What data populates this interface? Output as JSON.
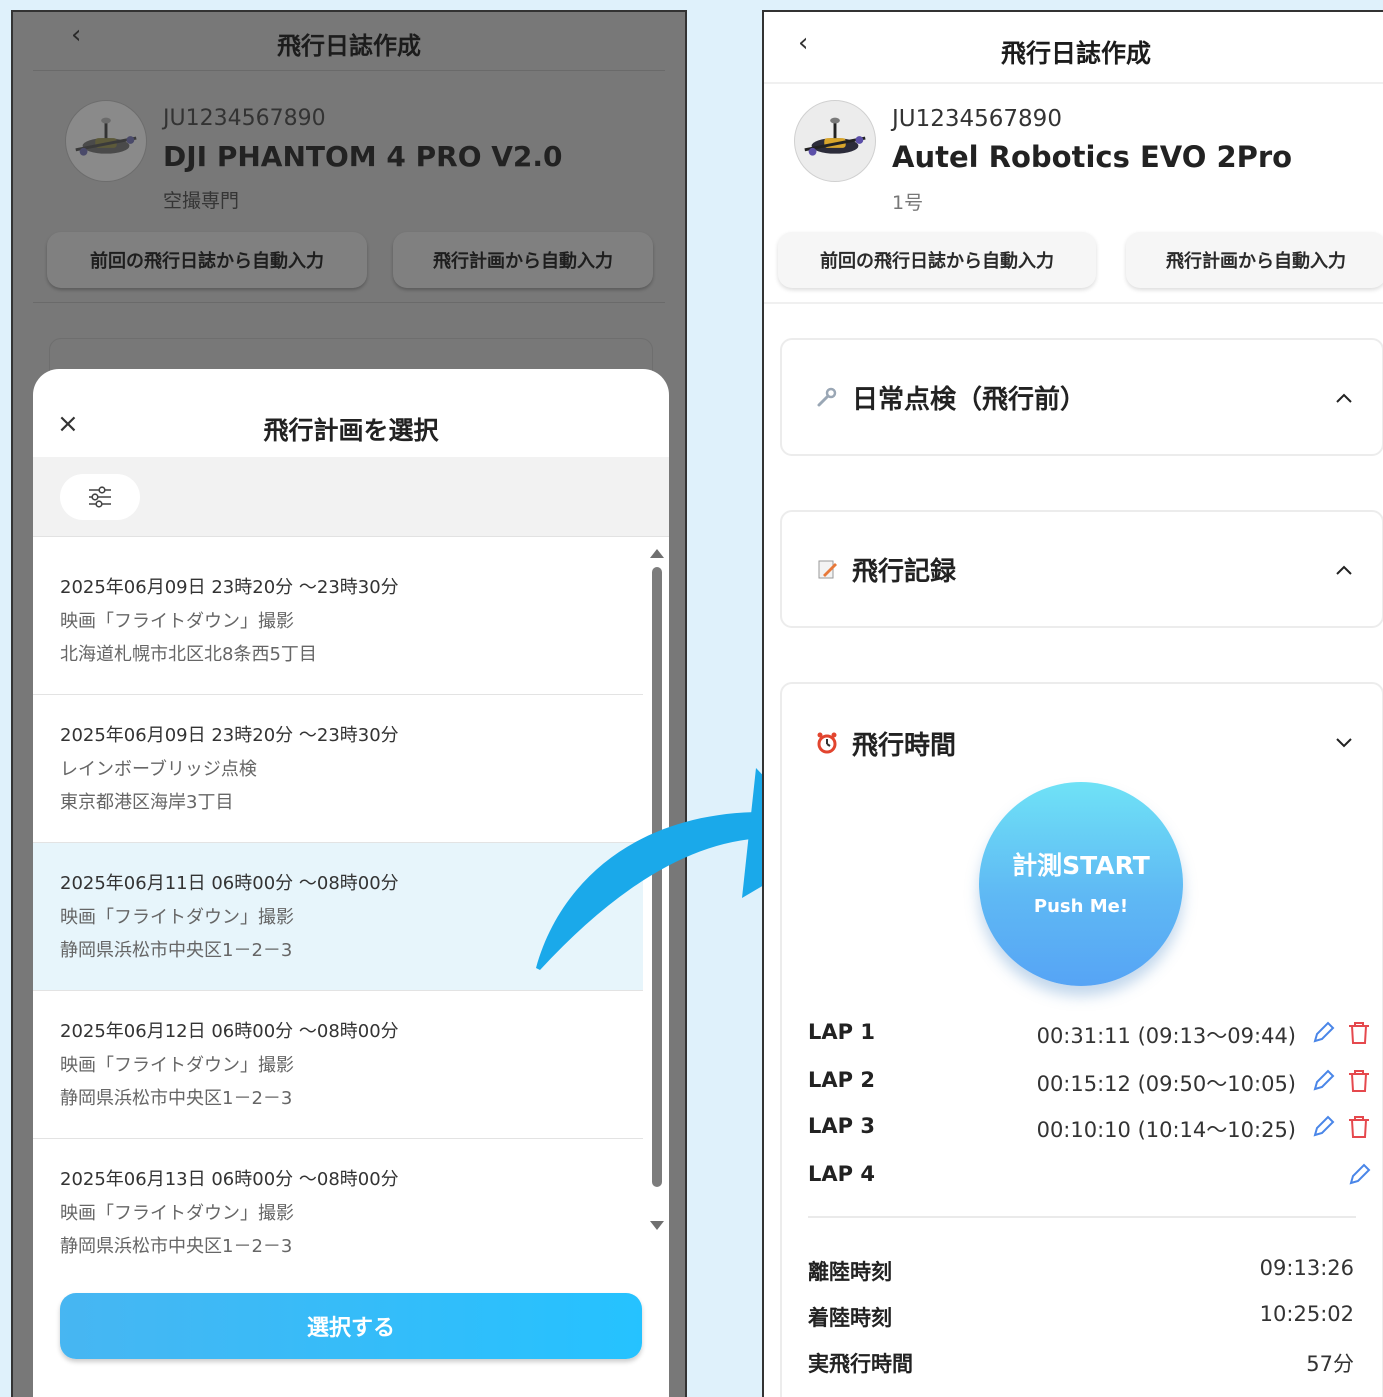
{
  "colors": {
    "background": "#dff1fb",
    "accent": "#1aa9ea",
    "danger": "#e5484d",
    "edit": "#4a86e8"
  },
  "left": {
    "back_icon": "chevron-left-icon",
    "title": "飛行日誌作成",
    "uav": {
      "id": "JU1234567890",
      "name": "DJI PHANTOM 4 PRO V2.0",
      "sub": "空撮専門"
    },
    "auto_prev": "前回の飛行日誌から自動入力",
    "auto_plan": "飛行計画から自動入力",
    "sheet": {
      "close": "×",
      "title": "飛行計画を選択",
      "filter_icon": "sliders-icon",
      "items": [
        {
          "date": "2025年06月09日 23時20分 ～23時30分",
          "name": "映画「フライトダウン」撮影",
          "addr": "北海道札幌市北区北8条西5丁目",
          "selected": false
        },
        {
          "date": "2025年06月09日 23時20分 ～23時30分",
          "name": "レインボーブリッジ点検",
          "addr": "東京都港区海岸3丁目",
          "selected": false
        },
        {
          "date": "2025年06月11日 06時00分 ～08時00分",
          "name": "映画「フライトダウン」撮影",
          "addr": "静岡県浜松市中央区1－2－3",
          "selected": true
        },
        {
          "date": "2025年06月12日 06時00分 ～08時00分",
          "name": "映画「フライトダウン」撮影",
          "addr": "静岡県浜松市中央区1－2－3",
          "selected": false
        },
        {
          "date": "2025年06月13日 06時00分 ～08時00分",
          "name": "映画「フライトダウン」撮影",
          "addr": "静岡県浜松市中央区1－2－3",
          "selected": false
        }
      ],
      "select_label": "選択する"
    }
  },
  "right": {
    "back_icon": "chevron-left-icon",
    "title": "飛行日誌作成",
    "uav": {
      "id": "JU1234567890",
      "name": "Autel Robotics EVO 2Pro",
      "sub": "1号"
    },
    "auto_prev": "前回の飛行日誌から自動入力",
    "auto_plan": "飛行計画から自動入力",
    "sections": [
      {
        "label": "日常点検（飛行前）",
        "icon": "wrench-icon",
        "expanded": false
      },
      {
        "label": "飛行記録",
        "icon": "memo-icon",
        "expanded": false
      },
      {
        "label": "飛行時間",
        "icon": "alarm-clock-icon",
        "expanded": true
      }
    ],
    "timer": {
      "main": "計測START",
      "sub": "Push Me!"
    },
    "laps": [
      {
        "label": "LAP 1",
        "value": "00:31:11 (09:13～09:44)",
        "deletable": true
      },
      {
        "label": "LAP 2",
        "value": "00:15:12 (09:50～10:05)",
        "deletable": true
      },
      {
        "label": "LAP 3",
        "value": "00:10:10 (10:14～10:25)",
        "deletable": true
      },
      {
        "label": "LAP 4",
        "value": "",
        "deletable": false
      }
    ],
    "summary": [
      {
        "label": "離陸時刻",
        "value": "09:13:26"
      },
      {
        "label": "着陸時刻",
        "value": "10:25:02"
      },
      {
        "label": "実飛行時間",
        "value": "57分"
      }
    ]
  }
}
